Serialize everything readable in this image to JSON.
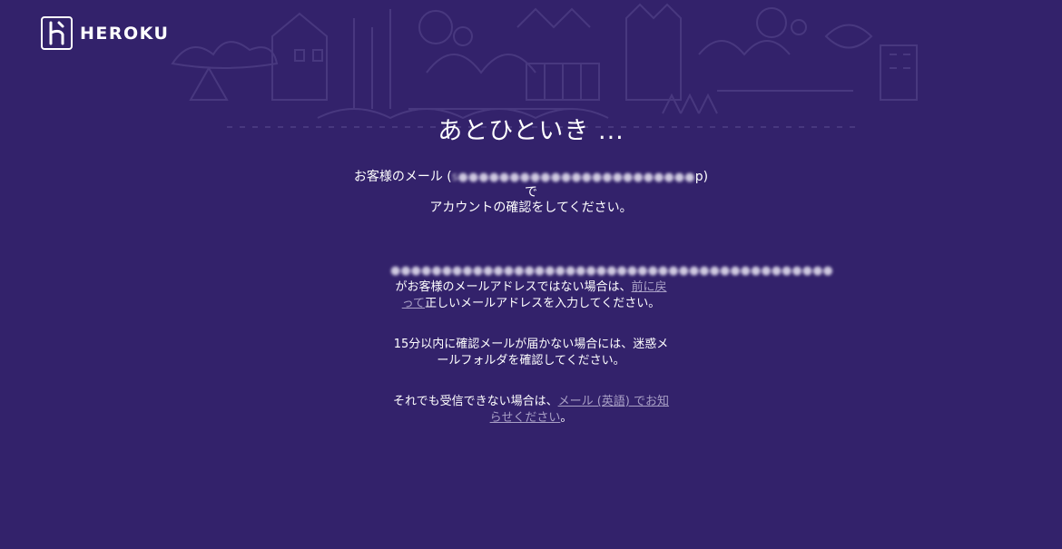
{
  "brand": {
    "name": "HEROKU",
    "logo_icon": "heroku-h-icon"
  },
  "main": {
    "title": "あとひといき ...",
    "confirm": {
      "prefix": "お客様のメール (",
      "email_redacted": "s●●●●●●●●●●●●●●●●●●●●●●●●●●●●●●●●●●●●●●●●●●●●●●●",
      "suffix": "p)",
      "line2": "で",
      "line3": "アカウントの確認をしてください。"
    },
    "wrong_email": {
      "email_redacted": "●●●●●●●●●●●●●●●●●●●●●●●●●●●●●●●●●●●●●●●●●●●",
      "text_before": " がお客様のメールアドレスではない場合は、",
      "link": "前に戻って",
      "text_after": "正しいメールアドレスを入力してください。"
    },
    "spam_note": "15分以内に確認メールが届かない場合には、迷惑メールフォルダを確認してください。",
    "contact": {
      "text_before": "それでも受信できない場合は、",
      "link": "メール (英語) でお知らせください",
      "text_after": "。"
    }
  },
  "colors": {
    "background": "#33226b",
    "text": "#ffffff",
    "link": "#a9a0c6"
  }
}
